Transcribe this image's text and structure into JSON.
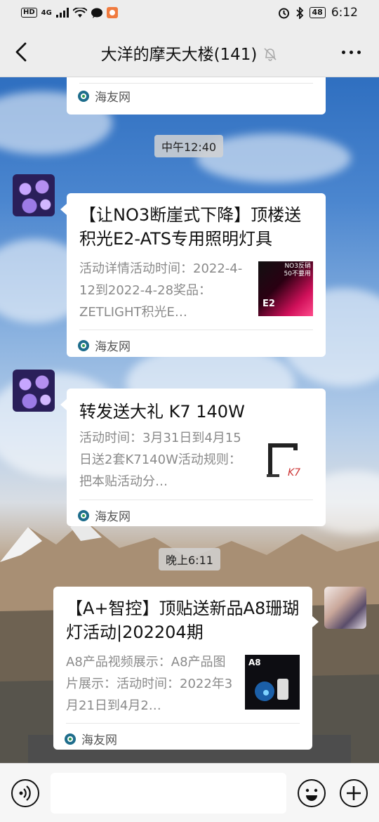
{
  "status_bar": {
    "hd": "HD",
    "network": "4G",
    "battery": "48",
    "time": "6:12"
  },
  "header": {
    "title": "大洋的摩天大楼(141)"
  },
  "messages": [
    {
      "source": "海友网"
    },
    {
      "time": "中午12:40"
    },
    {
      "title": "【让NO3断崖式下降】顶楼送积光E2-ATS专用照明灯具",
      "desc": "活动详情活动时间：2022-4-12到2022-4-28奖品：ZETLIGHT积光E…",
      "thumb_text": "NO3反硝\n50不要用",
      "thumb_brand": "E2",
      "source": "海友网"
    },
    {
      "title": "转发送大礼 K7 140W",
      "desc": "活动时间：3月31日到4月15日送2套K7140W活动规则：把本贴活动分…",
      "source": "海友网"
    },
    {
      "time": "晚上6:11"
    },
    {
      "title": "【A+智控】顶贴送新品A8珊瑚灯活动|202204期",
      "desc": "A8产品视频展示：A8产品图片展示：活动时间：2022年3月21日到4月2…",
      "thumb_text": "A8",
      "source": "海友网"
    }
  ],
  "input_bar": {
    "placeholder": ""
  }
}
